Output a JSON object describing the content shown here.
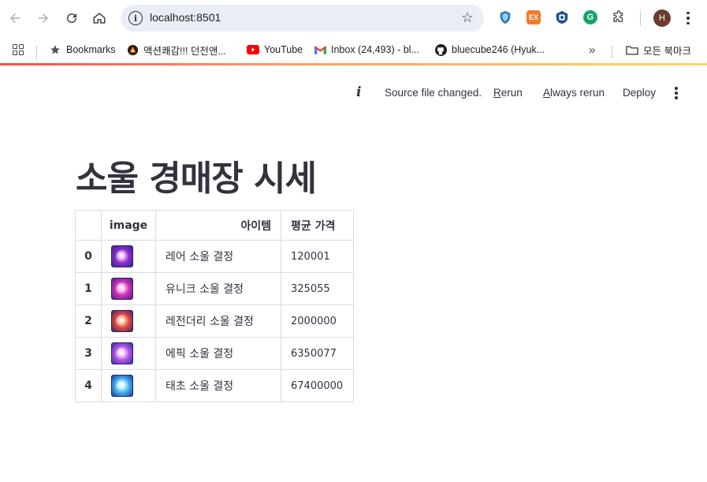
{
  "browser": {
    "url": "localhost:8501",
    "profile_initial": "H",
    "ext_ex_label": "EX",
    "ext_g_label": "G"
  },
  "bookmarks": {
    "items": [
      {
        "label": "Bookmarks",
        "icon": "star-icon"
      },
      {
        "label": "액션쾌감!!! 던전앤...",
        "icon": "dungeon-favicon"
      },
      {
        "label": "YouTube",
        "icon": "youtube-icon"
      },
      {
        "label": "Inbox (24,493) - bl...",
        "icon": "gmail-icon"
      },
      {
        "label": "bluecube246 (Hyuk...",
        "icon": "github-icon"
      }
    ],
    "more": "»",
    "folder_label": "모든 북마크"
  },
  "streamlit_header": {
    "status": "Source file changed.",
    "rerun_first": "R",
    "rerun_rest": "erun",
    "always_first": "A",
    "always_rest": "lways rerun",
    "deploy": "Deploy"
  },
  "main": {
    "title": "소울 경매장 시세",
    "table": {
      "columns": [
        "",
        "image",
        "아이템",
        "평균 가격"
      ],
      "rows": [
        {
          "index": "0",
          "item": "레어 소울 결정",
          "price": "120001",
          "orb_colors": [
            "#f2a6ff",
            "#8e2fd0",
            "#3a1f8a"
          ]
        },
        {
          "index": "1",
          "item": "유니크 소울 결정",
          "price": "325055",
          "orb_colors": [
            "#ffb0f0",
            "#d033b8",
            "#5a1a8a"
          ]
        },
        {
          "index": "2",
          "item": "레전더리 소울 결정",
          "price": "2000000",
          "orb_colors": [
            "#ffc48a",
            "#e0503a",
            "#4a1a6e"
          ]
        },
        {
          "index": "3",
          "item": "에픽 소울 결정",
          "price": "6350077",
          "orb_colors": [
            "#ffd0ff",
            "#b85ae8",
            "#3a2aa0"
          ]
        },
        {
          "index": "4",
          "item": "태초 소울 결정",
          "price": "67400000",
          "orb_colors": [
            "#d6ffff",
            "#4ab8f0",
            "#1a3a9a"
          ]
        }
      ]
    }
  }
}
